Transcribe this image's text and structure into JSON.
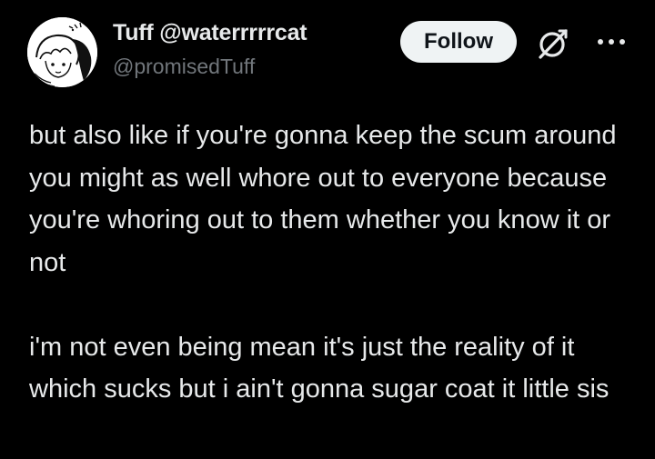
{
  "author": {
    "display_name": "Tuff @waterrrrrcat",
    "handle": "@promisedTuff",
    "avatar_icon": "anime-drawing-avatar"
  },
  "actions": {
    "follow_label": "Follow",
    "grok_icon": "grok-icon",
    "more_icon": "more-options-icon"
  },
  "tweet": {
    "paragraph_1": "but also like if you're gonna keep the scum around you might as well whore out to everyone because you're whoring out to them whether you know it or not",
    "paragraph_2": "i'm not even being mean it's just the reality of it which sucks but i ain't gonna sugar coat it little sis"
  },
  "colors": {
    "background": "#000000",
    "text_primary": "#e7e9ea",
    "text_secondary": "#71767b",
    "follow_bg": "#eff3f4",
    "follow_text": "#0f1419"
  }
}
